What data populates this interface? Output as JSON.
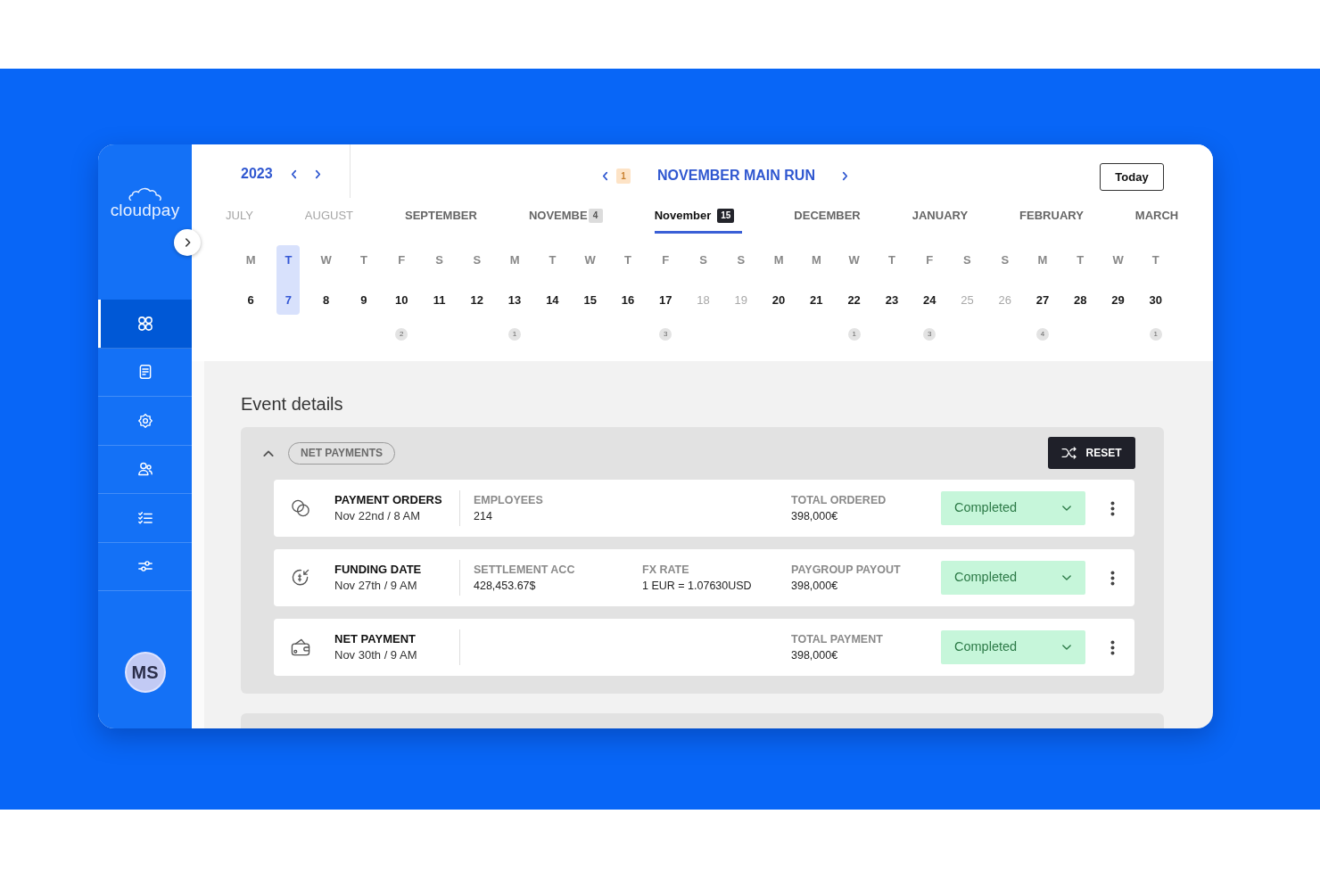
{
  "sidebar": {
    "logo": "cloudpay",
    "items": [
      {
        "kind": "dashboard",
        "selected": true
      },
      {
        "kind": "document",
        "selected": false
      },
      {
        "kind": "settings",
        "selected": false
      },
      {
        "kind": "people",
        "selected": false
      },
      {
        "kind": "checklist",
        "selected": false
      },
      {
        "kind": "filters",
        "selected": false
      }
    ],
    "avatar": "MS"
  },
  "calendar": {
    "year": "2023",
    "run": {
      "badge": "1",
      "title": "NOVEMBER MAIN RUN"
    },
    "today_button": "Today",
    "months": [
      {
        "label": "JULY",
        "selected": false,
        "disabled": true
      },
      {
        "label": "AUGUST",
        "selected": false,
        "disabled": true
      },
      {
        "label": "SEPTEMBER",
        "selected": false,
        "disabled": false
      },
      {
        "label": "NOVEMBE",
        "badge": "4",
        "selected": false,
        "disabled": false
      },
      {
        "label": "November",
        "badge": "15",
        "selected": true,
        "disabled": false
      },
      {
        "label": "DECEMBER",
        "selected": false,
        "disabled": false
      },
      {
        "label": "JANUARY",
        "selected": false,
        "disabled": false
      },
      {
        "label": "FEBRUARY",
        "selected": false,
        "disabled": false
      },
      {
        "label": "MARCH",
        "selected": false,
        "disabled": false
      }
    ],
    "days": [
      {
        "weekday": "M",
        "date": "6",
        "selected": false,
        "dimmed": false
      },
      {
        "weekday": "T",
        "date": "7",
        "selected": true,
        "dimmed": false
      },
      {
        "weekday": "W",
        "date": "8",
        "selected": false,
        "dimmed": false
      },
      {
        "weekday": "T",
        "date": "9",
        "selected": false,
        "dimmed": false
      },
      {
        "weekday": "F",
        "date": "10",
        "selected": false,
        "dimmed": false,
        "events": "2"
      },
      {
        "weekday": "S",
        "date": "11",
        "selected": false,
        "dimmed": false
      },
      {
        "weekday": "S",
        "date": "12",
        "selected": false,
        "dimmed": false
      },
      {
        "weekday": "M",
        "date": "13",
        "selected": false,
        "dimmed": false,
        "events": "1"
      },
      {
        "weekday": "T",
        "date": "14",
        "selected": false,
        "dimmed": false
      },
      {
        "weekday": "W",
        "date": "15",
        "selected": false,
        "dimmed": false
      },
      {
        "weekday": "T",
        "date": "16",
        "selected": false,
        "dimmed": false
      },
      {
        "weekday": "F",
        "date": "17",
        "selected": false,
        "dimmed": false,
        "events": "3"
      },
      {
        "weekday": "S",
        "date": "18",
        "selected": false,
        "dimmed": true
      },
      {
        "weekday": "S",
        "date": "19",
        "selected": false,
        "dimmed": true
      },
      {
        "weekday": "M",
        "date": "20",
        "selected": false,
        "dimmed": false
      },
      {
        "weekday": "M",
        "date": "21",
        "selected": false,
        "dimmed": false
      },
      {
        "weekday": "W",
        "date": "22",
        "selected": false,
        "dimmed": false,
        "events": "1"
      },
      {
        "weekday": "T",
        "date": "23",
        "selected": false,
        "dimmed": false
      },
      {
        "weekday": "F",
        "date": "24",
        "selected": false,
        "dimmed": false,
        "events": "3"
      },
      {
        "weekday": "S",
        "date": "25",
        "selected": false,
        "dimmed": true
      },
      {
        "weekday": "S",
        "date": "26",
        "selected": false,
        "dimmed": true
      },
      {
        "weekday": "M",
        "date": "27",
        "selected": false,
        "dimmed": false,
        "events": "4"
      },
      {
        "weekday": "T",
        "date": "28",
        "selected": false,
        "dimmed": false
      },
      {
        "weekday": "W",
        "date": "29",
        "selected": false,
        "dimmed": false
      },
      {
        "weekday": "T",
        "date": "30",
        "selected": false,
        "dimmed": false,
        "events": "1"
      }
    ]
  },
  "event_details": {
    "title": "Event details",
    "groups": [
      {
        "label": "NET PAYMENTS",
        "expanded": true,
        "reset_button": "RESET",
        "rows": [
          {
            "kind": "orders",
            "title": "PAYMENT ORDERS",
            "date": "Nov 22nd / 8 AM",
            "fields": [
              {
                "kind": "detail",
                "label": "EMPLOYEES",
                "value": "214"
              },
              {
                "kind": "total",
                "label": "TOTAL ORDERED",
                "value": "398,000€"
              }
            ],
            "status": {
              "label": "Completed",
              "kind": "success"
            }
          },
          {
            "kind": "funding",
            "title": "FUNDING DATE",
            "date": "Nov 27th / 9 AM",
            "fields": [
              {
                "kind": "detail",
                "label": "SETTLEMENT ACC",
                "value": "428,453.67$"
              },
              {
                "kind": "detail",
                "label": "FX RATE",
                "value": "1 EUR = 1.07630USD"
              },
              {
                "kind": "total",
                "label": "PAYGROUP PAYOUT",
                "value": "398,000€"
              }
            ],
            "status": {
              "label": "Completed",
              "kind": "success"
            }
          },
          {
            "kind": "payment",
            "title": "NET PAYMENT",
            "date": "Nov 30th / 9 AM",
            "fields": [
              {
                "kind": "total",
                "label": "TOTAL PAYMENT",
                "value": "398,000€"
              }
            ],
            "status": {
              "label": "Completed",
              "kind": "success"
            }
          }
        ]
      }
    ]
  }
}
